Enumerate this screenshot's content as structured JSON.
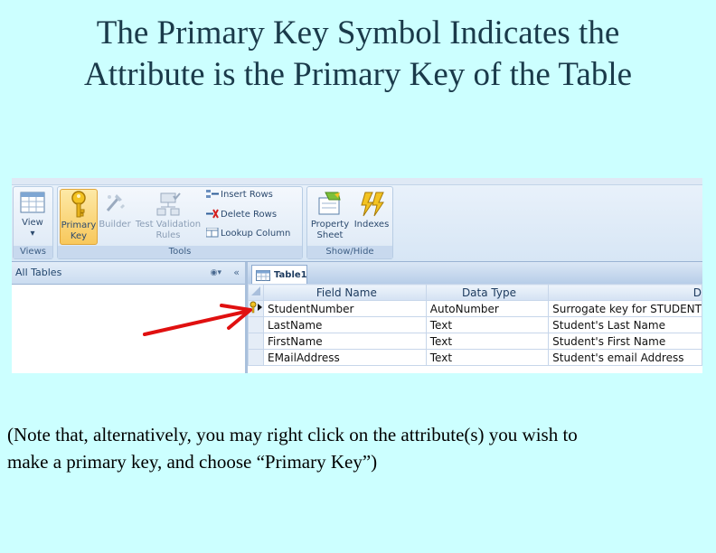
{
  "slide": {
    "title_line1": "The Primary Key Symbol Indicates the",
    "title_line2": "Attribute is the Primary Key of the Table",
    "note_line1": "(Note that, alternatively, you may right click on the attribute(s) you wish to",
    "note_line2": "make a primary key, and choose “Primary Key”)"
  },
  "ribbon": {
    "groups": {
      "views": "Views",
      "tools": "Tools",
      "show_hide": "Show/Hide"
    },
    "view_label": "View",
    "primary_key_line1": "Primary",
    "primary_key_line2": "Key",
    "builder_label": "Builder",
    "test_validation_line1": "Test Validation",
    "test_validation_line2": "Rules",
    "insert_rows": "Insert Rows",
    "delete_rows": "Delete Rows",
    "lookup_column": "Lookup Column",
    "property_sheet_line1": "Property",
    "property_sheet_line2": "Sheet",
    "indexes_label": "Indexes"
  },
  "nav": {
    "title": "All Tables"
  },
  "table_tab": "Table1",
  "design_grid": {
    "headers": [
      "Field Name",
      "Data Type",
      "D"
    ],
    "rows": [
      {
        "field": "StudentNumber",
        "type": "AutoNumber",
        "desc": "Surrogate key for STUDENT"
      },
      {
        "field": "LastName",
        "type": "Text",
        "desc": "Student's Last Name"
      },
      {
        "field": "FirstName",
        "type": "Text",
        "desc": "Student's First Name"
      },
      {
        "field": "EMailAddress",
        "type": "Text",
        "desc": "Student's email Address"
      }
    ]
  },
  "colors": {
    "background": "#ccffff",
    "title": "#1a3a4a",
    "annotation_arrow": "#e01010",
    "current_row_underline": "#f0b646"
  },
  "icons": [
    "view-icon",
    "primary-key-icon",
    "builder-icon",
    "test-validation-icon",
    "insert-rows-icon",
    "delete-rows-icon",
    "lookup-column-icon",
    "property-sheet-icon",
    "indexes-icon",
    "table-icon",
    "key-row-icon",
    "red-arrow-annotation"
  ]
}
